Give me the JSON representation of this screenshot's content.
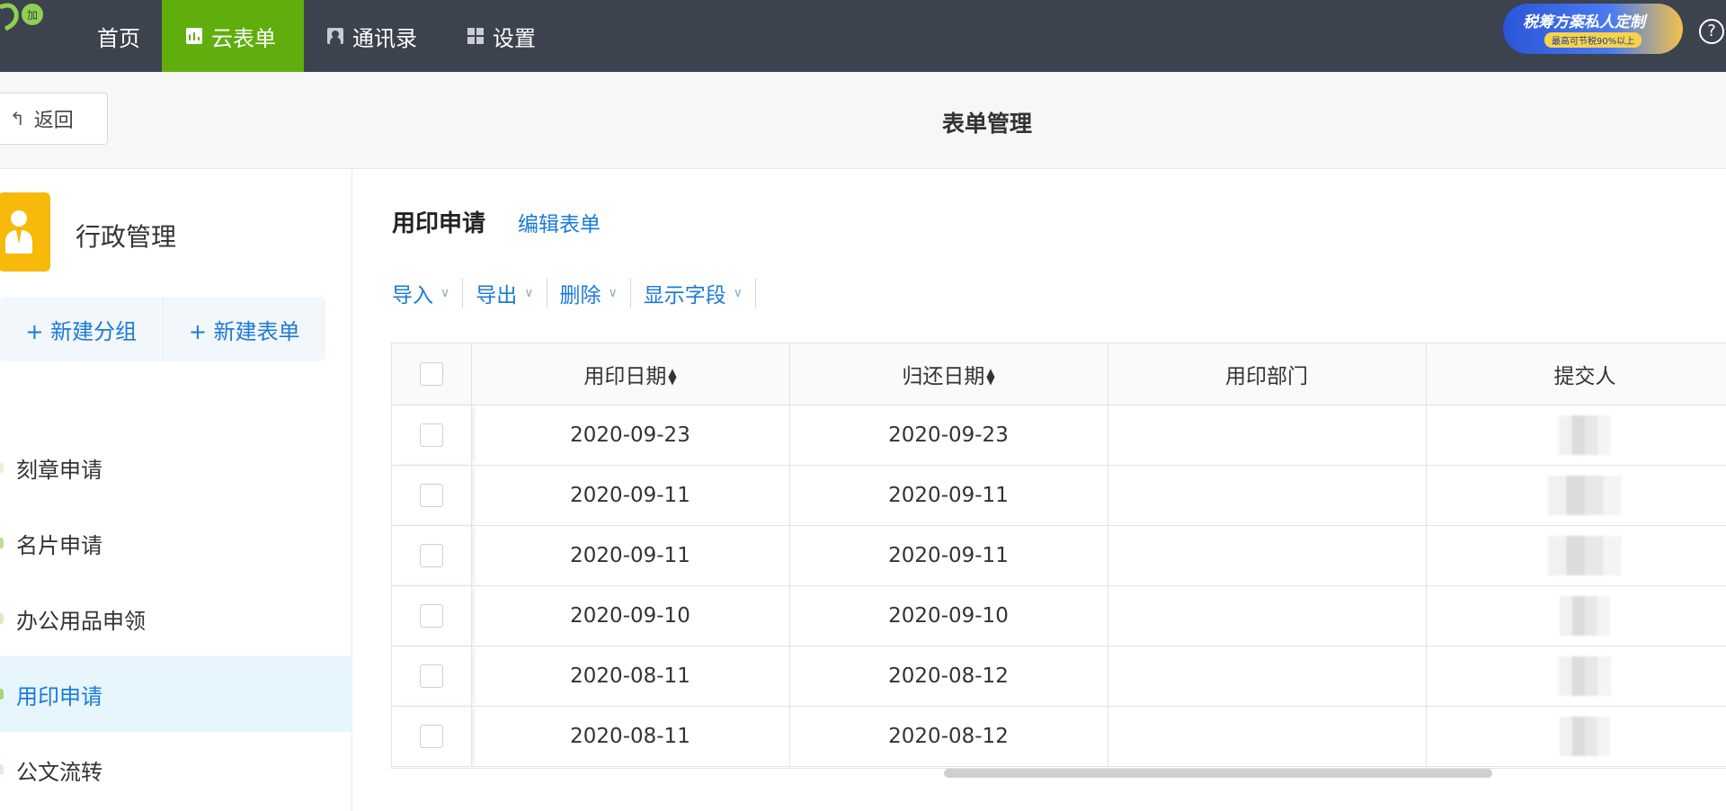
{
  "topnav": {
    "logo_text": "加",
    "items": [
      {
        "label": "首页",
        "icon": "none",
        "active": false
      },
      {
        "label": "云表单",
        "icon": "chart-icon",
        "active": true
      },
      {
        "label": "通讯录",
        "icon": "contact-icon",
        "active": false
      },
      {
        "label": "设置",
        "icon": "grid-icon",
        "active": false
      }
    ],
    "promo": {
      "line1": "税筹方案私人定制",
      "line2": "最高可节税90%以上"
    },
    "help": "?"
  },
  "subheader": {
    "back_label": "返回",
    "back_icon": "↰",
    "title": "表单管理"
  },
  "sidebar": {
    "group_name": "行政管理",
    "new_group": "+ 新建分组",
    "new_form": "+ 新建表单",
    "items": [
      {
        "label": "刻章申请",
        "dot_color": "#e8f3d7",
        "active": false
      },
      {
        "label": "名片申请",
        "dot_color": "#b8df8e",
        "active": false
      },
      {
        "label": "办公用品申领",
        "dot_color": "#d7ecbd",
        "active": false
      },
      {
        "label": "用印申请",
        "dot_color": "#a8d86f",
        "active": true
      },
      {
        "label": "公文流转",
        "dot_color": "#e3e6f5",
        "active": false
      }
    ]
  },
  "main": {
    "title": "用印申请",
    "edit_link": "编辑表单",
    "toolbar": [
      {
        "label": "导入"
      },
      {
        "label": "导出"
      },
      {
        "label": "删除"
      },
      {
        "label": "显示字段"
      }
    ],
    "table": {
      "headers": [
        "用印日期",
        "归还日期",
        "用印部门",
        "提交人"
      ],
      "rows": [
        {
          "date": "2020-09-23",
          "return": "2020-09-23",
          "dept": "",
          "submitter_redacted": true
        },
        {
          "date": "2020-09-11",
          "return": "2020-09-11",
          "dept": "",
          "submitter_redacted": true
        },
        {
          "date": "2020-09-11",
          "return": "2020-09-11",
          "dept": "",
          "submitter_redacted": true
        },
        {
          "date": "2020-09-10",
          "return": "2020-09-10",
          "dept": "",
          "submitter_redacted": true
        },
        {
          "date": "2020-08-11",
          "return": "2020-08-12",
          "dept": "",
          "submitter_redacted": true
        },
        {
          "date": "2020-08-11",
          "return": "2020-08-12",
          "dept": "",
          "submitter_redacted": true
        }
      ]
    }
  },
  "colors": {
    "nav_bg": "#3c424e",
    "nav_active": "#5fae0e",
    "link": "#1a7ad8",
    "group_icon": "#f7b90a"
  }
}
